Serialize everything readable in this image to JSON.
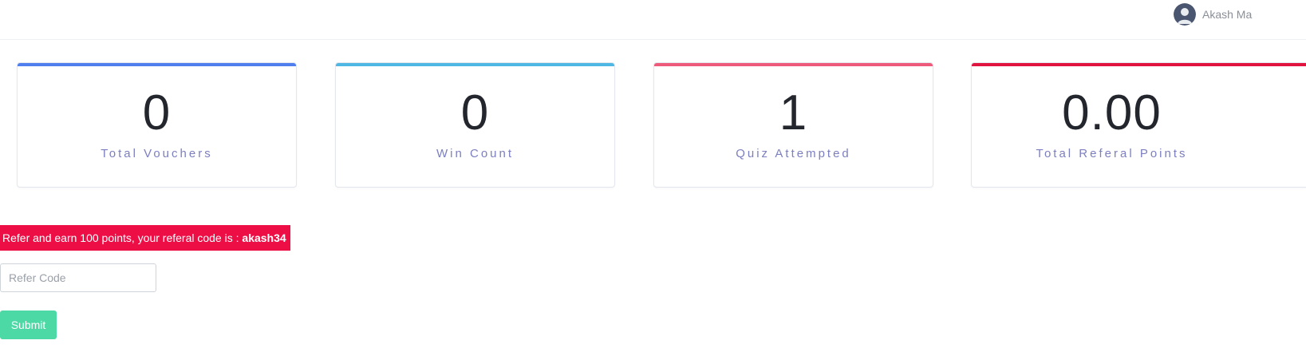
{
  "header": {
    "user_name": "Akash Ma"
  },
  "stats": [
    {
      "value": "0",
      "label": "Total Vouchers",
      "accent": "#4f7fee"
    },
    {
      "value": "0",
      "label": "Win Count",
      "accent": "#4fb7e3"
    },
    {
      "value": "1",
      "label": "Quiz Attempted",
      "accent": "#ee5a7a"
    },
    {
      "value": "0.00",
      "label": "Total Referal Points",
      "accent": "#e0143f"
    }
  ],
  "referral": {
    "message": "Refer and earn 100 points, your referal code is : ",
    "code": "akash34",
    "banner_color": "#ee0e46",
    "input_placeholder": "Refer Code",
    "input_value": "",
    "submit_label": "Submit",
    "submit_color": "#4cd9a6"
  }
}
